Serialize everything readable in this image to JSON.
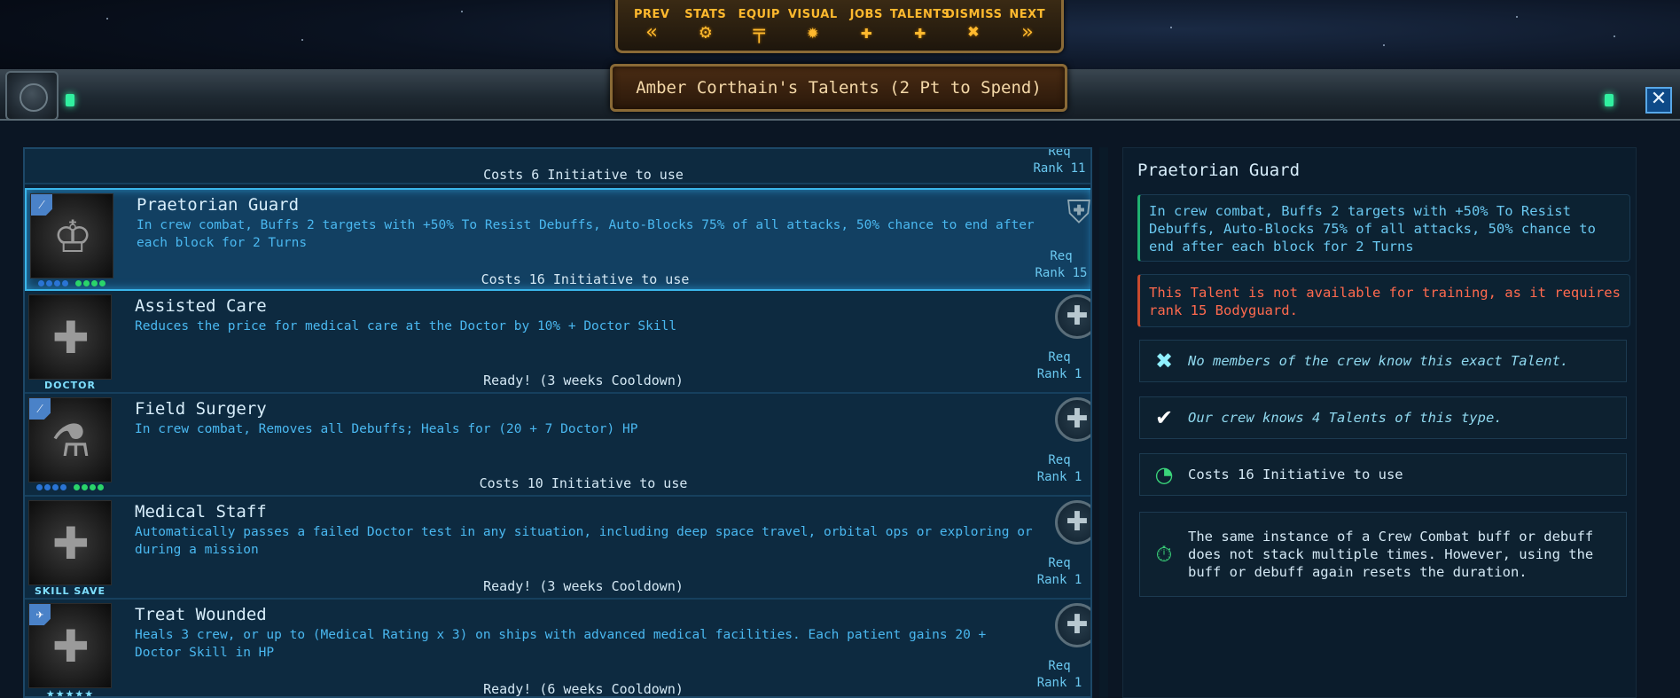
{
  "nav": {
    "items": [
      {
        "label": "PREV",
        "icon": "double-chevron-left-icon",
        "glyph": "«"
      },
      {
        "label": "STATS",
        "icon": "gear-icon",
        "glyph": "⚙"
      },
      {
        "label": "EQUIP",
        "icon": "pistol-icon",
        "glyph": "╤"
      },
      {
        "label": "VISUAL",
        "icon": "sun-icon",
        "glyph": "✹"
      },
      {
        "label": "JOBS",
        "icon": "job-plus-icon",
        "glyph": "✚"
      },
      {
        "label": "TALENTS",
        "icon": "talent-plus-icon",
        "glyph": "✚"
      },
      {
        "label": "DISMISS",
        "icon": "x-icon",
        "glyph": "✖"
      },
      {
        "label": "NEXT",
        "icon": "double-chevron-right-icon",
        "glyph": "»"
      }
    ]
  },
  "header": {
    "title": "Amber Corthain's Talents (2 Pt to Spend)",
    "close_glyph": "✕"
  },
  "list": {
    "partial_row": {
      "cost": "Costs 6 Initiative to use",
      "req_line1": "Req",
      "req_line2": "Rank 11"
    },
    "rows": [
      {
        "name": "Praetorian Guard",
        "desc": "In crew combat, Buffs 2 targets with +50% To Resist Debuffs, Auto-Blocks 75% of all attacks, 50% chance to end after each block for 2 Turns",
        "cost": "Costs 16 Initiative to use",
        "req_line1": "Req",
        "req_line2": "Rank 15",
        "icon_glyph": "♔",
        "badge": "⁄",
        "tag": ""
      },
      {
        "name": "Assisted Care",
        "desc": "Reduces the price for medical care at the Doctor by 10% + Doctor Skill",
        "cost": "Ready! (3 weeks Cooldown)",
        "req_line1": "Req",
        "req_line2": "Rank 1",
        "icon_glyph": "✚",
        "badge": "",
        "tag": "DOCTOR"
      },
      {
        "name": "Field Surgery",
        "desc": "In crew combat, Removes all Debuffs; Heals for (20 + 7 Doctor) HP",
        "cost": "Costs 10 Initiative to use",
        "req_line1": "Req",
        "req_line2": "Rank 1",
        "icon_glyph": "⚗",
        "badge": "⁄",
        "tag": ""
      },
      {
        "name": "Medical Staff",
        "desc": "Automatically passes a failed Doctor test in any situation, including deep space travel, orbital ops or exploring or during a mission",
        "cost": "Ready! (3 weeks Cooldown)",
        "req_line1": "Req",
        "req_line2": "Rank 1",
        "icon_glyph": "✚",
        "badge": "",
        "tag": "SKILL SAVE"
      },
      {
        "name": "Treat Wounded",
        "desc": "Heals 3 crew, or up to (Medical Rating x 3) on ships with advanced medical facilities. Each patient gains 20 + Doctor Skill in HP",
        "cost": "Ready! (6 weeks Cooldown)",
        "req_line1": "Req",
        "req_line2": "Rank 1",
        "icon_glyph": "✚",
        "badge": "✈",
        "tag": "★★★★★"
      }
    ]
  },
  "detail": {
    "title": "Praetorian Guard",
    "description": "In crew combat, Buffs 2 targets with +50% To Resist Debuffs, Auto-Blocks 75% of all attacks, 50% chance to end after each block for 2 Turns",
    "warning": "This Talent is not available for training, as it requires rank 15 Bodyguard.",
    "facts": [
      {
        "icon": "x-icon",
        "glyph": "✖",
        "color": "#8ff0ff",
        "text": "No members of the crew know this exact Talent."
      },
      {
        "icon": "check-icon",
        "glyph": "✔",
        "color": "#ffffff",
        "text": "Our crew knows 4 Talents of this type."
      },
      {
        "icon": "speedometer-icon",
        "glyph": "◔",
        "color": "#3ad47a",
        "text": "Costs 16 Initiative to use"
      },
      {
        "icon": "stopwatch-icon",
        "glyph": "⏱",
        "color": "#3ad47a",
        "text": "The same instance of a Crew Combat buff or debuff does not stack multiple times. However, using the buff or debuff again resets the duration."
      }
    ]
  },
  "colors": {
    "accent_gold": "#ffb92e",
    "accent_cyan": "#3ab6ea",
    "warning": "#ff6a4e"
  }
}
